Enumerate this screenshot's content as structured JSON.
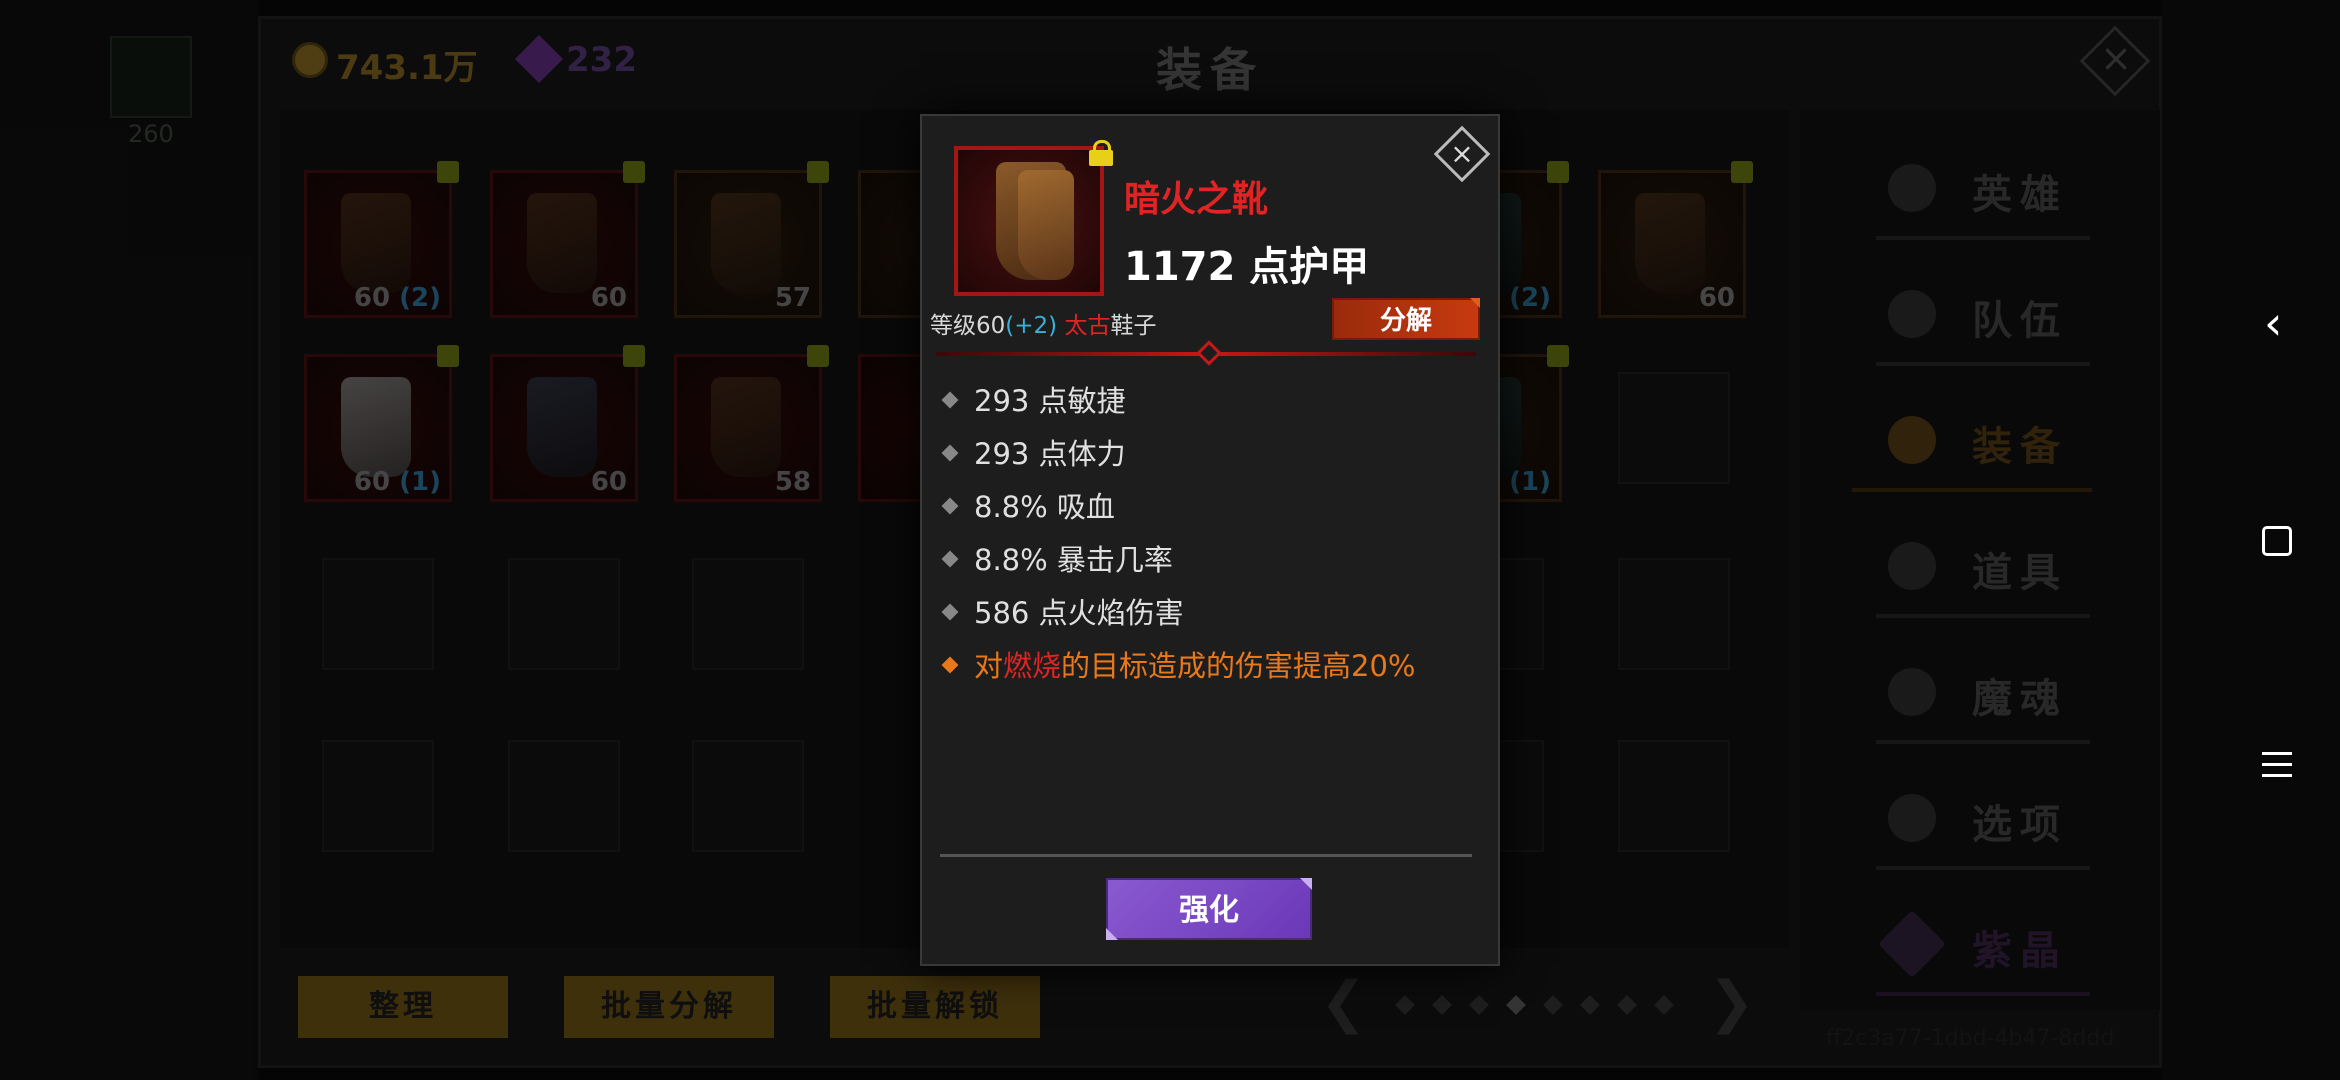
{
  "header": {
    "coins": "743.1万",
    "gems": "232",
    "title": "装备",
    "left_slot_count": "260"
  },
  "grid": {
    "row1": [
      {
        "level": "60",
        "bonus": "(2)"
      },
      {
        "level": "60",
        "bonus": ""
      },
      {
        "level": "57",
        "bonus": ""
      },
      {
        "level": "60",
        "bonus": "(2)"
      },
      {
        "level": "60",
        "bonus": ""
      }
    ],
    "row2": [
      {
        "level": "60",
        "bonus": "(1)"
      },
      {
        "level": "60",
        "bonus": ""
      },
      {
        "level": "58",
        "bonus": ""
      },
      {
        "level": "60",
        "bonus": "(1)"
      }
    ]
  },
  "bottom_buttons": {
    "sort": "整理",
    "bulk_decompose": "批量分解",
    "bulk_unlock": "批量解锁"
  },
  "pager": {
    "prev": "❮",
    "next": "❯",
    "total_pages": 8,
    "current_page": 4
  },
  "side_menu": [
    {
      "label": "英雄",
      "icon": "hero-icon"
    },
    {
      "label": "队伍",
      "icon": "flag-icon"
    },
    {
      "label": "装备",
      "icon": "helmet-icon",
      "active": true
    },
    {
      "label": "道具",
      "icon": "bag-icon"
    },
    {
      "label": "魔魂",
      "icon": "flame-icon"
    },
    {
      "label": "选项",
      "icon": "gear-icon"
    },
    {
      "label": "紫晶",
      "icon": "crystal-icon"
    }
  ],
  "uuid": "ff2c3a77-1dbd-4b47-8ddd",
  "popup": {
    "item_name": "暗火之靴",
    "armor": "1172 点护甲",
    "meta_prefix": "等级60",
    "meta_bonus": "(+2)",
    "meta_quality": "太古",
    "meta_type": "鞋子",
    "decompose_label": "分解",
    "close": "×",
    "stats": [
      "293 点敏捷",
      "293 点体力",
      "8.8% 吸血",
      "8.8% 暴击几率",
      "586 点火焰伤害"
    ],
    "special_prefix": "对",
    "special_highlight": "燃烧",
    "special_suffix": "的目标造成的伤害提高20%",
    "enhance_label": "强化"
  },
  "nav": {
    "back": "‹"
  },
  "colors": {
    "item_name": "#e02424",
    "bonus": "#38b0d8",
    "special": "#e8781a",
    "enhance": "#7a48c4",
    "decompose": "#b8320e"
  }
}
